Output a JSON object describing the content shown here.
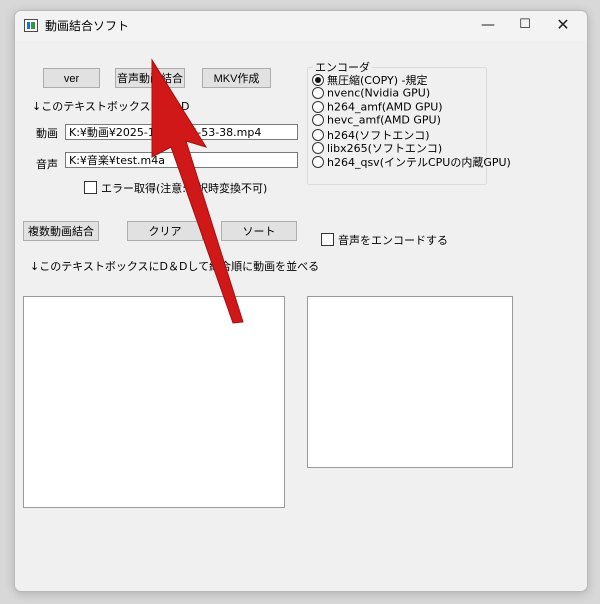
{
  "window": {
    "title": "動画結合ソフト",
    "min_glyph": "—",
    "max_glyph": "☐",
    "close_glyph": "✕"
  },
  "buttons": {
    "ver": "ver",
    "audio_video_merge": "音声動画結合",
    "mkv_create": "MKV作成",
    "multi_merge": "複数動画結合",
    "clear": "クリア",
    "sort": "ソート"
  },
  "drop_hint_top": "↓このテキストボックスにD＆D",
  "video": {
    "label": "動画",
    "value": "K:¥動画¥2025-10-1■04-53-38.mp4"
  },
  "audio": {
    "label": "音声",
    "value": "K:¥音楽¥test.m4a"
  },
  "error_checkbox": {
    "label": "エラー取得(注意:選択時変換不可)",
    "checked": false
  },
  "encode_audio_checkbox": {
    "label": "音声をエンコードする",
    "checked": false
  },
  "drop_hint_bottom": "↓このテキストボックスにD＆Dして結合順に動画を並べる",
  "encoder": {
    "legend": "エンコーダ",
    "options": [
      {
        "label": "無圧縮(COPY) -規定",
        "checked": true
      },
      {
        "label": "nvenc(Nvidia GPU)",
        "checked": false
      },
      {
        "label": "h264_amf(AMD GPU)",
        "checked": false
      },
      {
        "label": "hevc_amf(AMD GPU)",
        "checked": false
      },
      {
        "label": "h264(ソフトエンコ)",
        "checked": false
      },
      {
        "label": "libx265(ソフトエンコ)",
        "checked": false
      },
      {
        "label": "h264_qsv(インテルCPUの内蔵GPU)",
        "checked": false
      }
    ]
  },
  "colors": {
    "annotation_arrow": "#d01818",
    "focus_border": "#0078d7"
  },
  "icons": {
    "app": "app-window-icon",
    "annotation": "red-arrow-annotation"
  }
}
